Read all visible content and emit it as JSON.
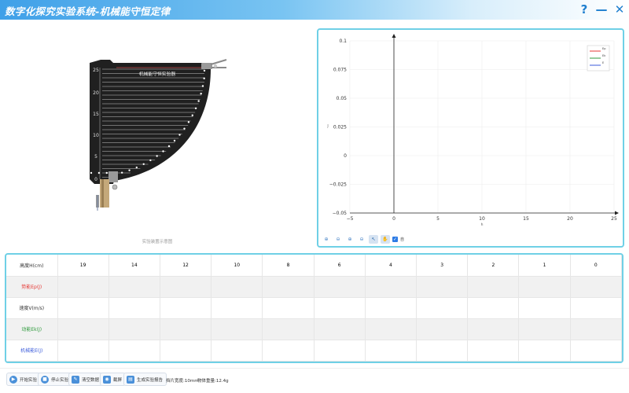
{
  "window": {
    "title": "数字化探究实验系统-机械能守恒定律",
    "help_label": "?",
    "minimize_label": "—",
    "close_label": "✕"
  },
  "apparatus": {
    "device_label": "机械能守恒实验器",
    "scale_ticks": [
      "25",
      "20",
      "15",
      "10",
      "5",
      "0"
    ],
    "caption": "实验装置示意图"
  },
  "chart_data": {
    "type": "line",
    "x_ticks": [
      "−5",
      "0",
      "5",
      "10",
      "15",
      "20",
      "25"
    ],
    "y_ticks": [
      "0.1",
      "0.075",
      "0.05",
      "0.025",
      "0",
      "−0.025",
      "−0.05"
    ],
    "xlim": [
      -5,
      25
    ],
    "ylim": [
      -0.05,
      0.1
    ],
    "xlabel": "h",
    "ylabel": "J",
    "grid": true,
    "legend_position": "top-right",
    "series": [
      {
        "name": "Ep",
        "color": "#e53935",
        "values": []
      },
      {
        "name": "Ek",
        "color": "#2e9a3c",
        "values": []
      },
      {
        "name": "E",
        "color": "#3b5bdb",
        "values": []
      }
    ]
  },
  "chart_tools": {
    "zoom_in_x": "⊕",
    "zoom_out_x": "⊖",
    "zoom_in_y": "⊕",
    "zoom_out_y": "⊖",
    "select": "↖",
    "pan": "✋",
    "checkbox_mark": "✓",
    "auto_label": "自"
  },
  "table": {
    "rows": [
      {
        "label": "高度H(cm)",
        "color": "#333333",
        "cells": [
          "19",
          "14",
          "12",
          "10",
          "8",
          "6",
          "4",
          "3",
          "2",
          "1",
          "0"
        ]
      },
      {
        "label": "势能Ep(J)",
        "color": "#e53935",
        "cells": [
          "",
          "",
          "",
          "",
          "",
          "",
          "",
          "",
          "",
          "",
          ""
        ]
      },
      {
        "label": "速度V(m/s)",
        "color": "#333333",
        "cells": [
          "",
          "",
          "",
          "",
          "",
          "",
          "",
          "",
          "",
          "",
          ""
        ]
      },
      {
        "label": "动能Ek(J)",
        "color": "#2e9a3c",
        "cells": [
          "",
          "",
          "",
          "",
          "",
          "",
          "",
          "",
          "",
          "",
          ""
        ]
      },
      {
        "label": "机械能E(J)",
        "color": "#3b5bdb",
        "cells": [
          "",
          "",
          "",
          "",
          "",
          "",
          "",
          "",
          "",
          "",
          ""
        ]
      }
    ]
  },
  "toolbar": {
    "start_label": "开始实验",
    "stop_label": "停止实验",
    "clear_label": "清空数据",
    "screenshot_label": "截屏",
    "report_label": "生成实验报告",
    "width_info": "挡片宽度:10mm",
    "mass_info": "物体重量:12.4g"
  }
}
